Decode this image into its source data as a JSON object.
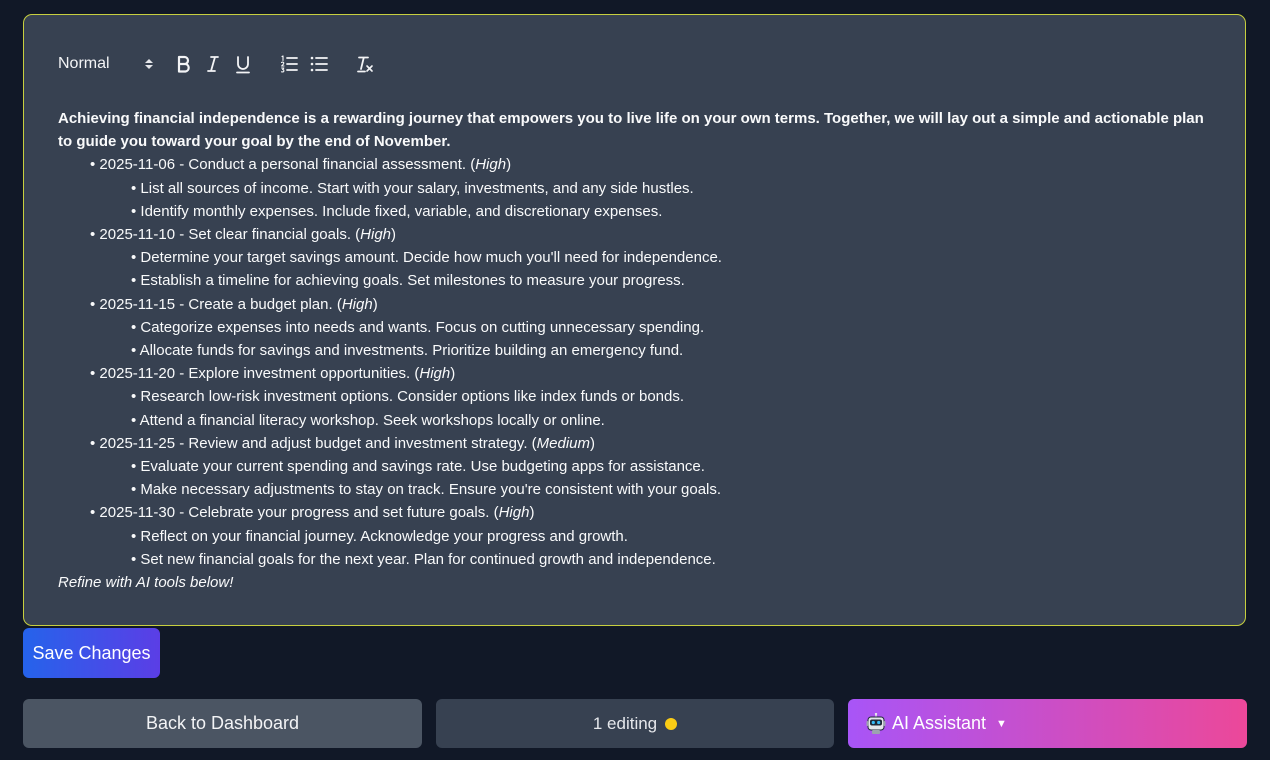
{
  "toolbar": {
    "format_label": "Normal",
    "buttons": [
      {
        "name": "bold",
        "icon": "bold-icon"
      },
      {
        "name": "italic",
        "icon": "italic-icon"
      },
      {
        "name": "underline",
        "icon": "underline-icon"
      },
      {
        "name": "ordered-list",
        "icon": "ordered-list-icon"
      },
      {
        "name": "bullet-list",
        "icon": "bullet-list-icon"
      },
      {
        "name": "clear-format",
        "icon": "clear-format-icon"
      }
    ]
  },
  "document": {
    "intro": "Achieving financial independence is a rewarding journey that empowers you to live life on your own terms. Together, we will lay out a simple and actionable plan to guide you toward your goal by the end of November.",
    "items": [
      {
        "date": "2025-11-06",
        "title": "Conduct a personal financial assessment.",
        "priority": "High",
        "subitems": [
          "List all sources of income. Start with your salary, investments, and any side hustles.",
          "Identify monthly expenses. Include fixed, variable, and discretionary expenses."
        ]
      },
      {
        "date": "2025-11-10",
        "title": "Set clear financial goals.",
        "priority": "High",
        "subitems": [
          "Determine your target savings amount. Decide how much you'll need for independence.",
          "Establish a timeline for achieving goals. Set milestones to measure your progress."
        ]
      },
      {
        "date": "2025-11-15",
        "title": "Create a budget plan.",
        "priority": "High",
        "subitems": [
          "Categorize expenses into needs and wants. Focus on cutting unnecessary spending.",
          "Allocate funds for savings and investments. Prioritize building an emergency fund."
        ]
      },
      {
        "date": "2025-11-20",
        "title": "Explore investment opportunities.",
        "priority": "High",
        "subitems": [
          "Research low-risk investment options. Consider options like index funds or bonds.",
          "Attend a financial literacy workshop. Seek workshops locally or online."
        ]
      },
      {
        "date": "2025-11-25",
        "title": "Review and adjust budget and investment strategy.",
        "priority": "Medium",
        "subitems": [
          "Evaluate your current spending and savings rate. Use budgeting apps for assistance.",
          "Make necessary adjustments to stay on track. Ensure you're consistent with your goals."
        ]
      },
      {
        "date": "2025-11-30",
        "title": "Celebrate your progress and set future goals.",
        "priority": "High",
        "subitems": [
          "Reflect on your financial journey. Acknowledge your progress and growth.",
          "Set new financial goals for the next year. Plan for continued growth and independence."
        ]
      }
    ],
    "outro": "Refine with AI tools below!"
  },
  "actions": {
    "save_label": "Save Changes",
    "back_label": "Back to Dashboard",
    "editing_label": "1 editing",
    "ai_label": "AI Assistant",
    "ai_icon": "robot-icon",
    "ai_caret": "▼"
  },
  "colors": {
    "background": "#111827",
    "editor_bg": "#374151",
    "editor_border": "#c7cf3f",
    "save_gradient": [
      "#2563eb",
      "#5b3ee6"
    ],
    "ai_gradient": [
      "#a855f7",
      "#ec4899"
    ],
    "status_dot": "#facc15"
  }
}
